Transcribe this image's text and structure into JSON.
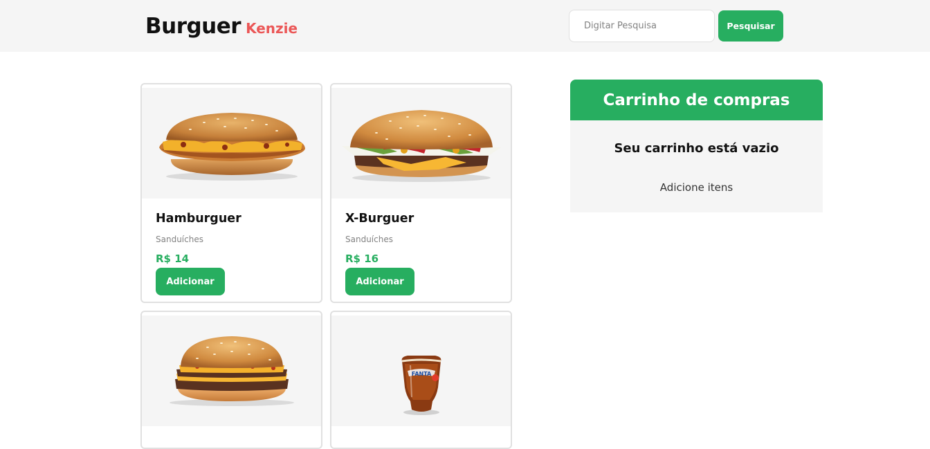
{
  "header": {
    "logo_main": "Burguer",
    "logo_sub": "Kenzie",
    "search_placeholder": "Digitar Pesquisa",
    "search_button": "Pesquisar"
  },
  "products": [
    {
      "name": "Hamburguer",
      "category": "Sanduíches",
      "price": "R$ 14",
      "button": "Adicionar",
      "icon": "hamburger-image"
    },
    {
      "name": "X-Burguer",
      "category": "Sanduíches",
      "price": "R$ 16",
      "button": "Adicionar",
      "icon": "cheeseburger-image"
    },
    {
      "name": "",
      "category": "",
      "price": "",
      "button": "",
      "icon": "burger-image"
    },
    {
      "name": "",
      "category": "",
      "price": "",
      "button": "",
      "icon": "fanta-cup-image"
    }
  ],
  "cart": {
    "title": "Carrinho de compras",
    "empty_title": "Seu carrinho está vazio",
    "empty_subtitle": "Adicione itens"
  },
  "colors": {
    "primary": "#27ae60",
    "accent": "#eb5757",
    "header_bg": "#f5f5f5"
  }
}
